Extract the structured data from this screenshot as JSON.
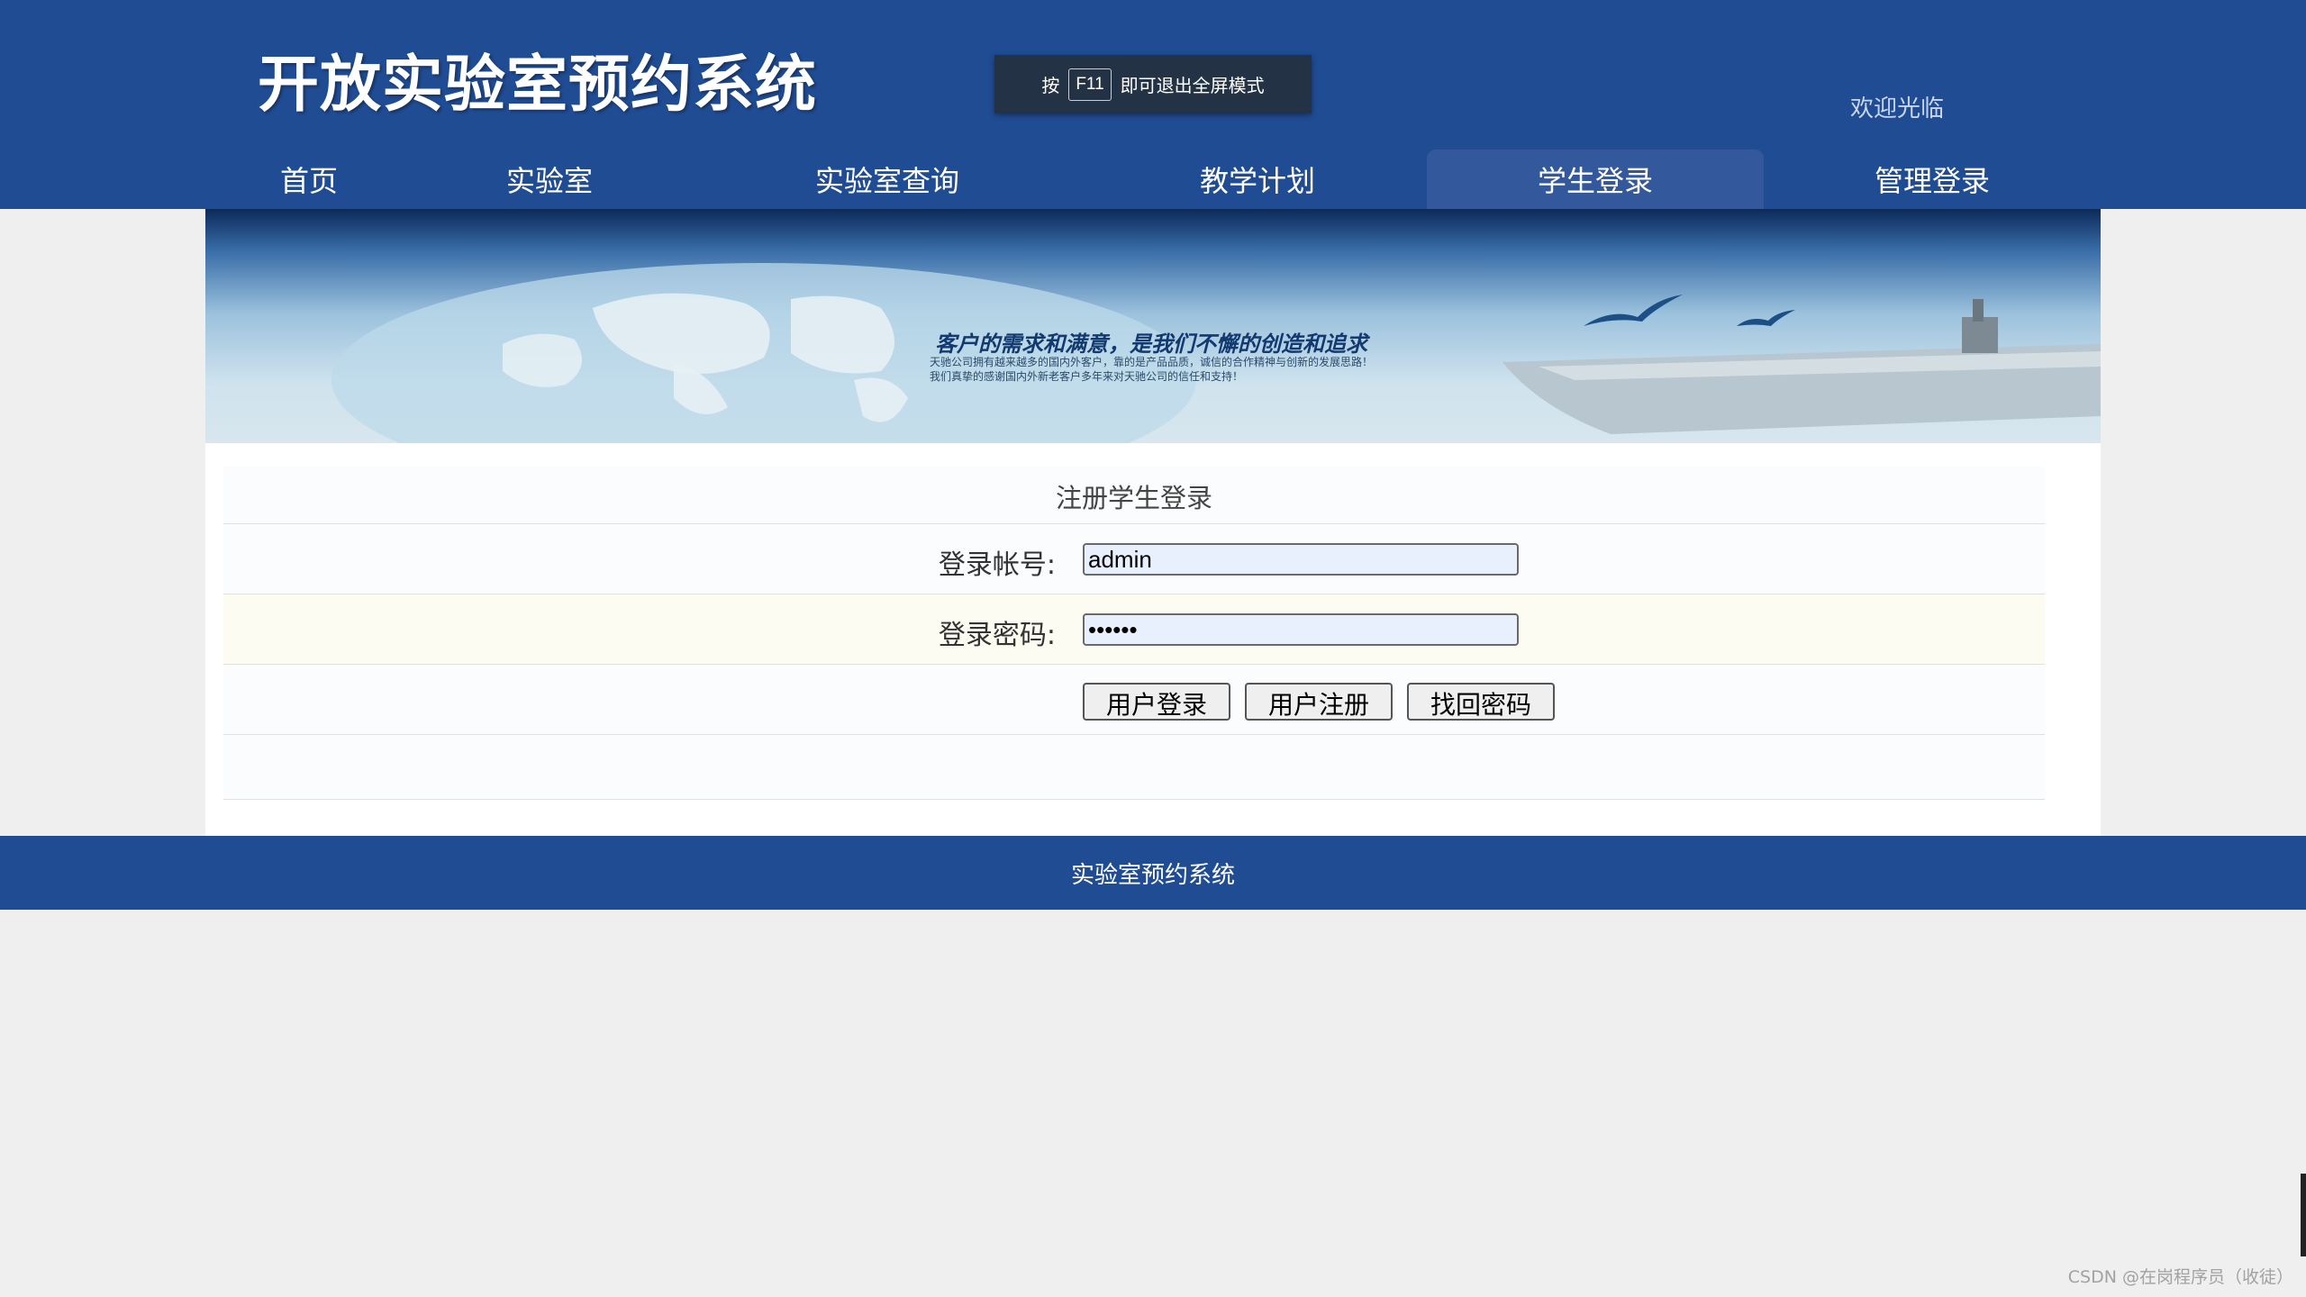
{
  "header": {
    "logo_text": "开放实验室预约系统",
    "welcome_text": "欢迎光临",
    "background_color": "#204c94"
  },
  "fullscreen_notice": {
    "prefix": "按",
    "key": "F11",
    "suffix": "即可退出全屏模式"
  },
  "nav": {
    "items": [
      {
        "label": "首页",
        "active": false
      },
      {
        "label": "实验室",
        "active": false
      },
      {
        "label": "实验室查询",
        "active": false
      },
      {
        "label": "教学计划",
        "active": false
      },
      {
        "label": "学生登录",
        "active": true
      },
      {
        "label": "管理登录",
        "active": false
      }
    ]
  },
  "banner": {
    "slogan": "客户的需求和满意，是我们不懈的创造和追求",
    "line1": "天驰公司拥有越来越多的国内外客户，靠的是产品品质，诚信的合作精神与创新的发展思路！",
    "line2": "我们真挚的感谢国内外新老客户多年来对天驰公司的信任和支持！"
  },
  "login_form": {
    "title": "注册学生登录",
    "account_label": "登录帐号:",
    "account_value": "admin",
    "password_label": "登录密码:",
    "password_value": "123456",
    "buttons": {
      "login": "用户登录",
      "register": "用户注册",
      "recover": "找回密码"
    }
  },
  "footer": {
    "text": "实验室预约系统"
  },
  "watermark": "CSDN @在岗程序员（收徒）"
}
